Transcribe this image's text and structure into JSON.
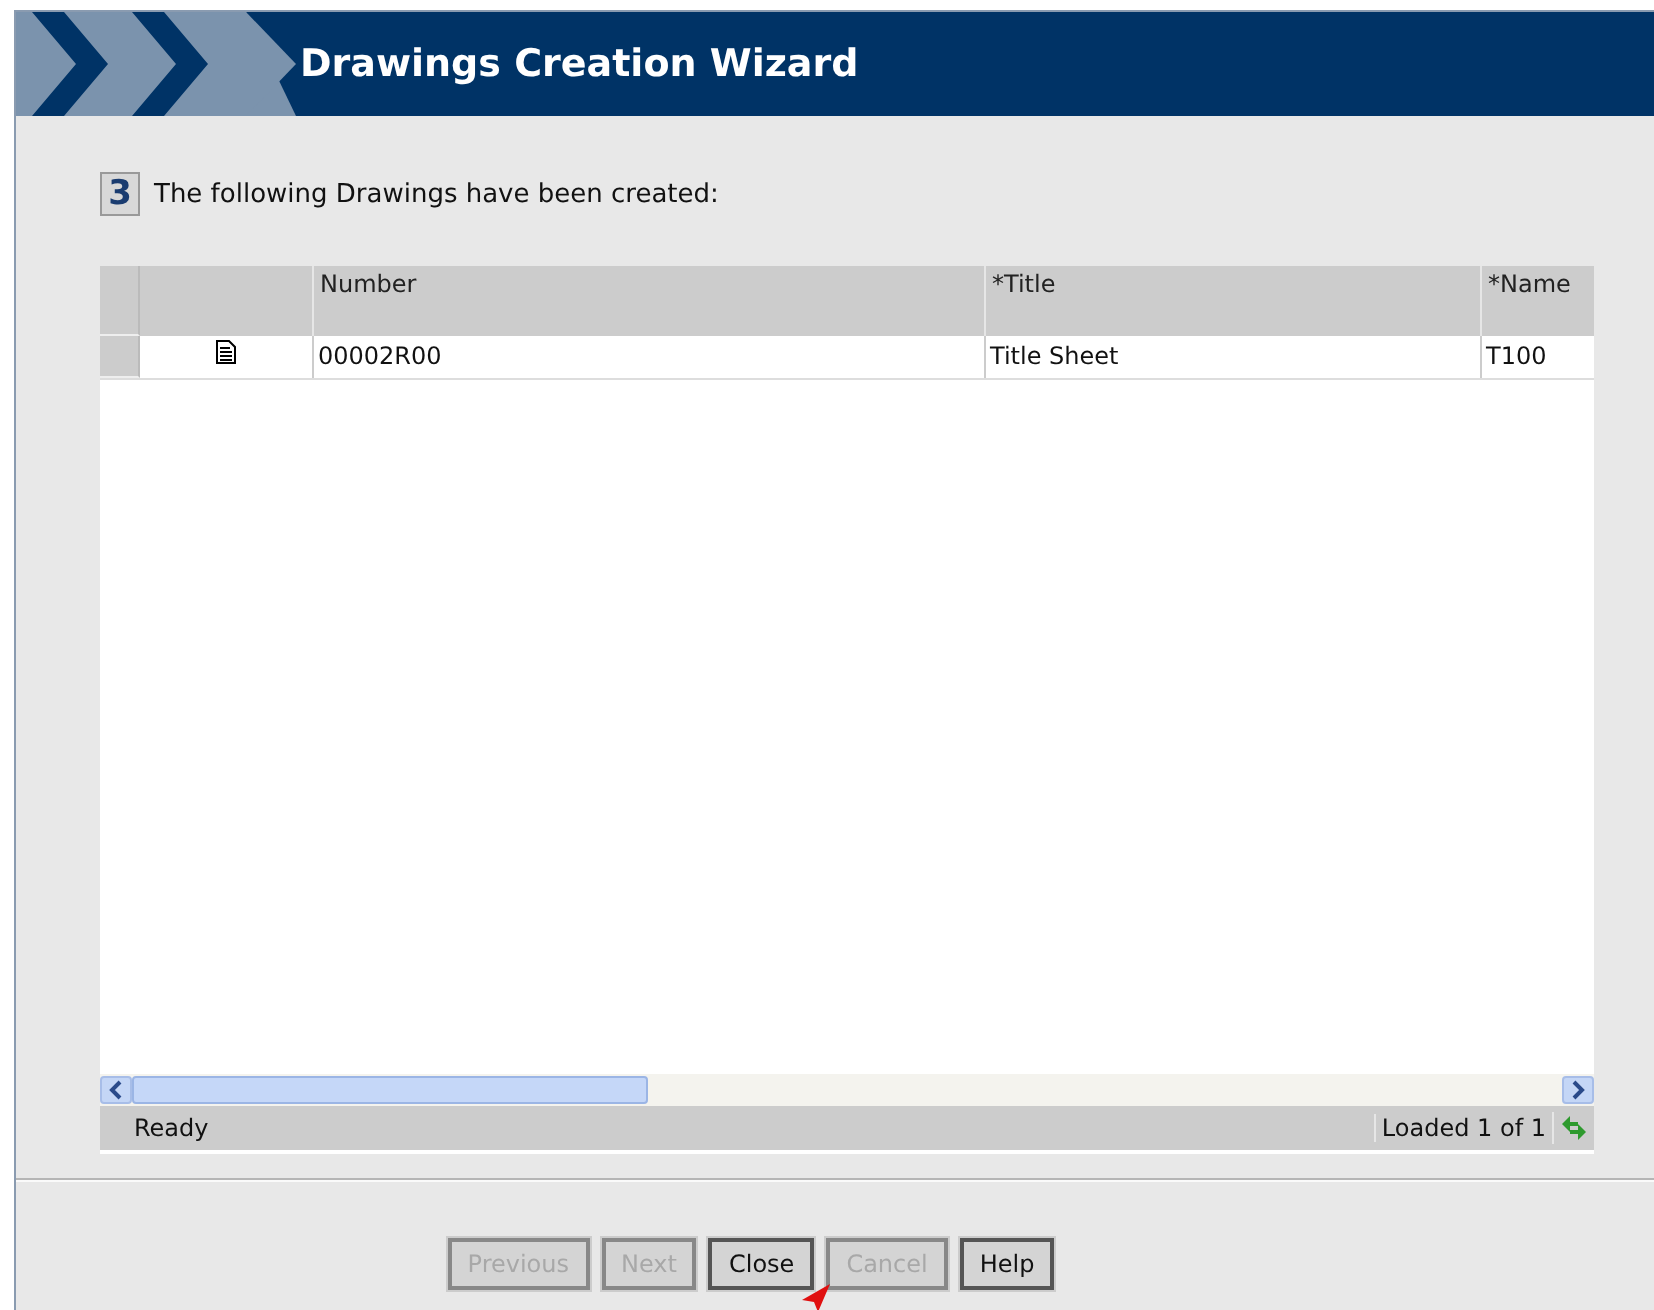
{
  "window": {
    "title": "Drawings Creation Wizard"
  },
  "step": {
    "number": "3",
    "text": "The following Drawings have been created:"
  },
  "table": {
    "columns": [
      "Number",
      "*Title",
      "*Name"
    ],
    "rows": [
      {
        "kind": "document",
        "cells": [
          "00002R00",
          "Title Sheet",
          "T100"
        ]
      }
    ]
  },
  "status_bar": {
    "status": "Ready",
    "loaded": "Loaded 1 of 1"
  },
  "buttons": [
    {
      "label": "Previous",
      "disabled": true
    },
    {
      "label": "Next",
      "disabled": true
    },
    {
      "label": "Close",
      "disabled": false
    },
    {
      "label": "Cancel",
      "disabled": true
    },
    {
      "label": "Help",
      "disabled": false
    }
  ]
}
